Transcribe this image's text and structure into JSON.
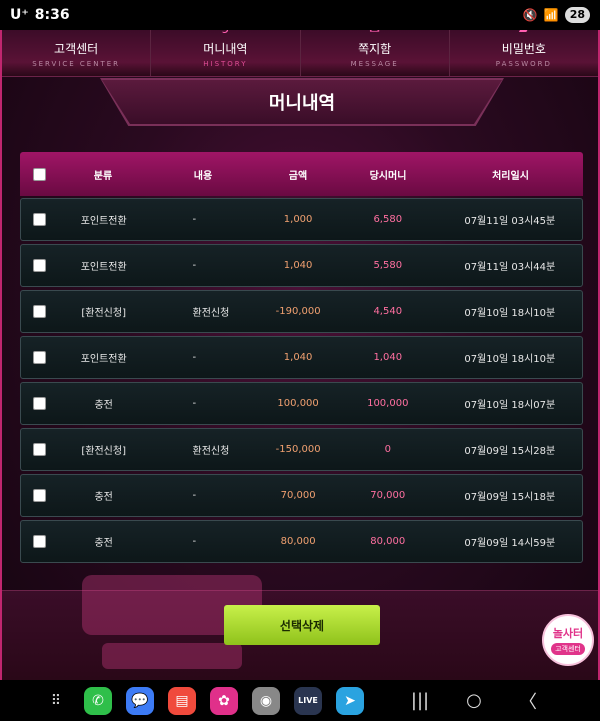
{
  "status_bar": {
    "carrier": "U⁺",
    "time": "8:36",
    "battery": "28"
  },
  "nav": [
    {
      "label": "고객센터",
      "sub": "SERVICE CENTER"
    },
    {
      "label": "머니내역",
      "sub": "HISTORY"
    },
    {
      "label": "쪽지함",
      "sub": "MESSAGE"
    },
    {
      "label": "비밀번호",
      "sub": "PASSWORD"
    }
  ],
  "page_title": "머니내역",
  "table": {
    "headers": {
      "category": "분류",
      "content": "내용",
      "amount": "금액",
      "balance": "당시머니",
      "date": "처리일시"
    },
    "rows": [
      {
        "category": "포인트전환",
        "content": "-",
        "amount": "1,000",
        "balance": "6,580",
        "date": "07월11일 03시45분"
      },
      {
        "category": "포인트전환",
        "content": "-",
        "amount": "1,040",
        "balance": "5,580",
        "date": "07월11일 03시44분"
      },
      {
        "category": "[환전신청]",
        "content": "환전신청",
        "amount": "-190,000",
        "balance": "4,540",
        "date": "07월10일 18시10분"
      },
      {
        "category": "포인트전환",
        "content": "-",
        "amount": "1,040",
        "balance": "1,040",
        "date": "07월10일 18시10분"
      },
      {
        "category": "충전",
        "content": "-",
        "amount": "100,000",
        "balance": "100,000",
        "date": "07월10일 18시07분"
      },
      {
        "category": "[환전신청]",
        "content": "환전신청",
        "amount": "-150,000",
        "balance": "0",
        "date": "07월09일 15시28분"
      },
      {
        "category": "충전",
        "content": "-",
        "amount": "70,000",
        "balance": "70,000",
        "date": "07월09일 15시18분"
      },
      {
        "category": "충전",
        "content": "-",
        "amount": "80,000",
        "balance": "80,000",
        "date": "07월09일 14시59분"
      }
    ]
  },
  "delete_button": "선택삭제",
  "cs_badge": {
    "logo": "놀사터",
    "label": "고객센터"
  },
  "colors": {
    "accent": "#c0266f",
    "button": "#a8dc2a",
    "amount": "#f0a070",
    "balance": "#ff6fa0"
  },
  "dock_icons": [
    "apps-icon",
    "phone-icon",
    "messages-icon",
    "notes-icon",
    "gallery-icon",
    "camera-icon",
    "livescore-icon",
    "telegram-icon"
  ],
  "dock_labels": {
    "livescore": "LIVE"
  }
}
